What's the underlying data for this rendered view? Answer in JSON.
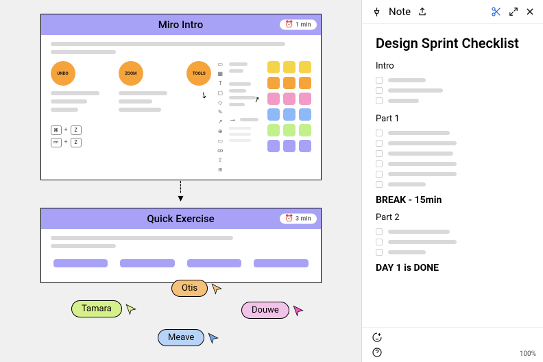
{
  "sidebar": {
    "header_label": "Note",
    "title": "Design Sprint Checklist",
    "sections": {
      "intro_label": "Intro",
      "part1_label": "Part 1",
      "break_label": "BREAK - 15min",
      "part2_label": "Part 2",
      "done_label": "DAY 1 is DONE"
    },
    "zoom": "100%"
  },
  "frames": {
    "intro": {
      "title": "Miro Intro",
      "time": "1 min",
      "buttons": {
        "undo": "UNDO",
        "zoom": "ZOOM",
        "tools": "TOOLS"
      },
      "kbd": {
        "cmd": "⌘",
        "ctrl": "ctrl",
        "z": "Z",
        "plus": "+"
      }
    },
    "exercise": {
      "title": "Quick Exercise",
      "time": "3 min"
    }
  },
  "cursors": {
    "tamara": "Tamara",
    "otis": "Otis",
    "douwe": "Douwe",
    "meave": "Meave"
  },
  "swatches": [
    "#f5d44a",
    "#f5d44a",
    "#f5d44a",
    "#f5a43c",
    "#f5a43c",
    "#f5a43c",
    "#f29bc7",
    "#f29bc7",
    "#f29bc7",
    "#8fb8f7",
    "#8fb8f7",
    "#8fb8f7",
    "#c2f08b",
    "#c2f08b",
    "#c2f08b",
    "#a8a2f7",
    "#a8a2f7",
    "#a8a2f7"
  ]
}
